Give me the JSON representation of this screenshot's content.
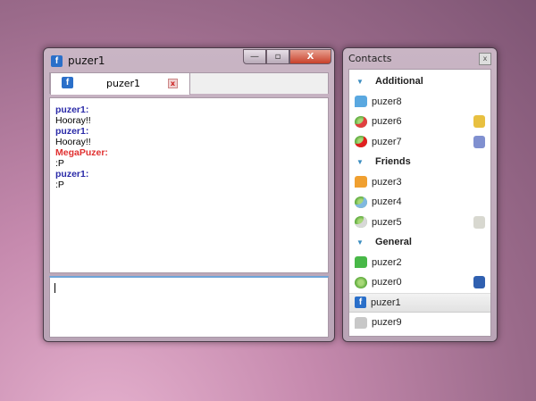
{
  "chat_window": {
    "title": "puzer1",
    "controls": {
      "minimize": "—",
      "maximize": "▫",
      "close": "X"
    },
    "tab": {
      "label": "puzer1",
      "close": "x"
    },
    "messages": [
      {
        "nick": "puzer1:",
        "text": "Hooray!!",
        "color": "#2a2aa8"
      },
      {
        "nick": "puzer1:",
        "text": "Hooray!!",
        "color": "#2a2aa8"
      },
      {
        "nick": "MegaPuzer:",
        "text": ":P",
        "color": "#e03030"
      },
      {
        "nick": "puzer1:",
        "text": ":P",
        "color": "#2a2aa8"
      }
    ],
    "input_value": ""
  },
  "contacts_window": {
    "title": "Contacts",
    "close": "x",
    "groups": [
      {
        "name": "Additional",
        "contacts": [
          {
            "name": "puzer8",
            "icon": "chat-bubble-blue-icon",
            "badge": null
          },
          {
            "name": "puzer6",
            "icon": "icq-flower-red-icon",
            "badge": "beer-mug-icon"
          },
          {
            "name": "puzer7",
            "icon": "icq-flower-angry-icon",
            "badge": "syringe-icon"
          }
        ]
      },
      {
        "name": "Friends",
        "contacts": [
          {
            "name": "puzer3",
            "icon": "chat-bubble-orange-icon",
            "badge": null
          },
          {
            "name": "puzer4",
            "icon": "icq-flower-away-icon",
            "badge": null
          },
          {
            "name": "puzer5",
            "icon": "icq-flower-na-icon",
            "badge": "toilet-paper-icon"
          }
        ]
      },
      {
        "name": "General",
        "contacts": [
          {
            "name": "puzer2",
            "icon": "chat-bubble-green-icon",
            "badge": null
          },
          {
            "name": "puzer0",
            "icon": "icq-flower-online-icon",
            "badge": "joystick-icon"
          },
          {
            "name": "puzer1",
            "icon": "facebook-icon",
            "badge": null,
            "selected": true
          },
          {
            "name": "puzer9",
            "icon": "chat-bubble-offline-icon",
            "badge": null
          }
        ]
      }
    ]
  }
}
